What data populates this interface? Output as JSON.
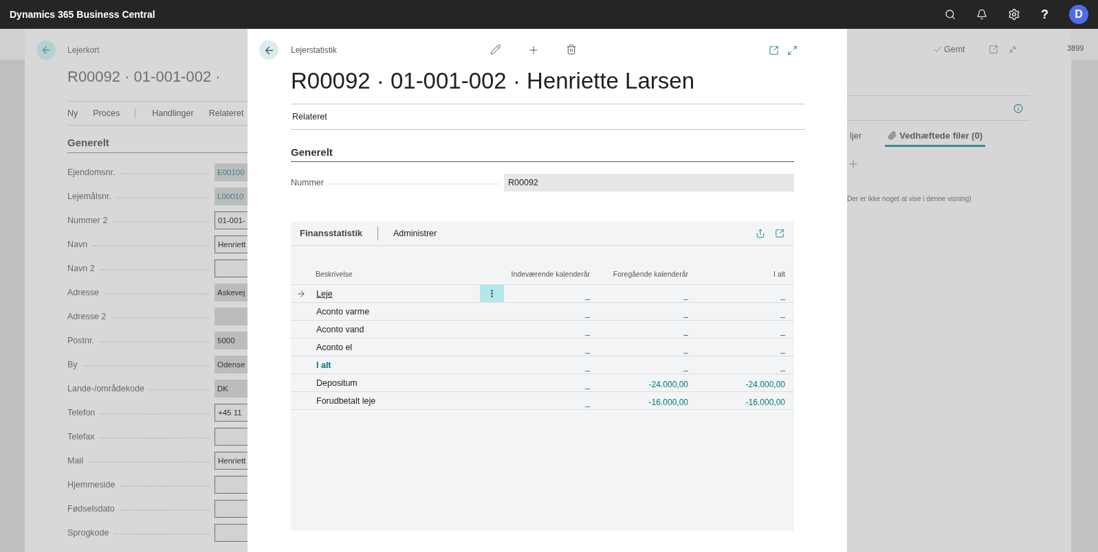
{
  "app": {
    "title": "Dynamics 365 Business Central",
    "help": "?",
    "avatar": "D"
  },
  "background_page": {
    "breadcrumb": "Lejerkort",
    "title": "R00092 · 01-001-002 ·",
    "action_groups": [
      [
        "Ny",
        "Proces"
      ],
      [
        "Handlinger",
        "Relateret"
      ]
    ],
    "section": "Generelt",
    "fields": [
      {
        "label": "Ejendomsnr.",
        "value": "E00100",
        "kind": "link"
      },
      {
        "label": "Lejemålsnr.",
        "value": "L00010",
        "kind": "link"
      },
      {
        "label": "Nummer 2",
        "value": "01-001-",
        "kind": "input"
      },
      {
        "label": "Navn",
        "value": "Henriett",
        "kind": "input"
      },
      {
        "label": "Navn 2",
        "kind": "input"
      },
      {
        "label": "Adresse",
        "value": "Askevej",
        "kind": "readonly"
      },
      {
        "label": "Adresse 2",
        "kind": "readonly"
      },
      {
        "label": "Postnr.",
        "value": "5000",
        "kind": "readonly"
      },
      {
        "label": "By",
        "value": "Odense",
        "kind": "readonly"
      },
      {
        "label": "Lande-/områdekode",
        "value": "DK",
        "kind": "readonly"
      },
      {
        "label": "Telefon",
        "value": "+45 11",
        "kind": "input"
      },
      {
        "label": "Telefax",
        "kind": "input"
      },
      {
        "label": "Mail",
        "value": "Henriett",
        "kind": "input"
      },
      {
        "label": "Hjemmeside",
        "kind": "input"
      },
      {
        "label": "Fødselsdato",
        "kind": "input"
      },
      {
        "label": "Sprogkode",
        "kind": "input"
      }
    ],
    "status": "Gemt",
    "factbox": {
      "tabs": [
        {
          "label": "ljer",
          "selected": false
        },
        {
          "label": "Vedhæftede filer (0)",
          "selected": true
        }
      ],
      "empty_message": "Der er ikke noget at vise i denne visning)"
    },
    "side_number": "3899"
  },
  "dialog": {
    "breadcrumb": "Lejerstatistik",
    "title": "R00092 · 01-001-002 · Henriette Larsen",
    "actions": [
      "Relateret"
    ],
    "section": "Generelt",
    "fields": [
      {
        "label": "Nummer",
        "value": "R00092"
      }
    ],
    "part": {
      "title": "Finansstatistik",
      "actions": [
        "Administrer"
      ],
      "columns": [
        "Beskrivelse",
        "Indeværende kalenderår",
        "Foregående kalenderår",
        "I alt"
      ],
      "rows": [
        {
          "kind": "line",
          "description": "Leje",
          "current": "_",
          "previous": "_",
          "total": "_",
          "selected": true
        },
        {
          "kind": "line",
          "description": "Aconto varme",
          "current": "_",
          "previous": "_",
          "total": "_",
          "selected": false
        },
        {
          "kind": "line",
          "description": "Aconto vand",
          "current": "_",
          "previous": "_",
          "total": "_",
          "selected": false
        },
        {
          "kind": "line",
          "description": "Aconto el",
          "current": "_",
          "previous": "_",
          "total": "_",
          "selected": false
        },
        {
          "kind": "total",
          "description": "I alt",
          "current": "_",
          "previous": "_",
          "total": "_",
          "selected": false
        },
        {
          "kind": "line",
          "description": "Depositum",
          "current": "_",
          "previous": "-24.000,00",
          "total": "-24.000,00",
          "selected": false
        },
        {
          "kind": "line",
          "description": "Forudbetalt leje",
          "current": "_",
          "previous": "-16.000,00",
          "total": "-16.000,00",
          "selected": false
        }
      ]
    }
  }
}
